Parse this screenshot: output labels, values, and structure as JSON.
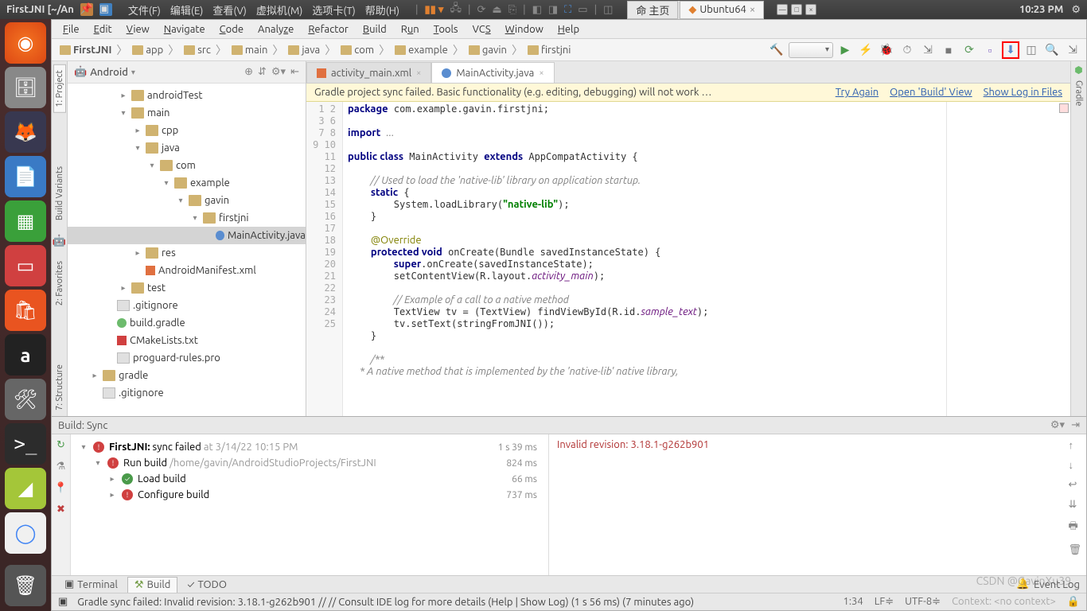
{
  "top": {
    "title": "FirstJNI [~/An",
    "vm_menus": [
      "文件(F)",
      "编辑(E)",
      "查看(V)",
      "虚拟机(M)",
      "选项卡(T)",
      "帮助(H)"
    ],
    "vm_tabs": [
      {
        "label": "命 主页"
      },
      {
        "label": "Ubuntu64",
        "close": true,
        "active": true
      }
    ],
    "clock": "10:23 PM"
  },
  "menu": [
    "File",
    "Edit",
    "View",
    "Navigate",
    "Code",
    "Analyze",
    "Refactor",
    "Build",
    "Run",
    "Tools",
    "VCS",
    "Window",
    "Help"
  ],
  "breadcrumb": [
    "FirstJNI",
    "app",
    "src",
    "main",
    "java",
    "com",
    "example",
    "gavin",
    "firstjni"
  ],
  "project": {
    "label": "Android",
    "tree": [
      {
        "d": 1,
        "a": "▸",
        "i": "folder",
        "t": "androidTest"
      },
      {
        "d": 1,
        "a": "▾",
        "i": "folder",
        "t": "main"
      },
      {
        "d": 2,
        "a": "▸",
        "i": "folder",
        "t": "cpp"
      },
      {
        "d": 2,
        "a": "▾",
        "i": "folder",
        "t": "java"
      },
      {
        "d": 3,
        "a": "▾",
        "i": "folder",
        "t": "com"
      },
      {
        "d": 4,
        "a": "▾",
        "i": "folder",
        "t": "example"
      },
      {
        "d": 5,
        "a": "▾",
        "i": "folder",
        "t": "gavin"
      },
      {
        "d": 6,
        "a": "▾",
        "i": "folder",
        "t": "firstjni"
      },
      {
        "d": 7,
        "a": "",
        "i": "java",
        "t": "MainActivity.java",
        "sel": true
      },
      {
        "d": 2,
        "a": "▸",
        "i": "folder",
        "t": "res"
      },
      {
        "d": 2,
        "a": "",
        "i": "xml",
        "t": "AndroidManifest.xml"
      },
      {
        "d": 1,
        "a": "▸",
        "i": "folder",
        "t": "test"
      },
      {
        "d": 0,
        "a": "",
        "i": "file",
        "t": ".gitignore"
      },
      {
        "d": 0,
        "a": "",
        "i": "gradle",
        "t": "build.gradle"
      },
      {
        "d": 0,
        "a": "",
        "i": "cmake",
        "t": "CMakeLists.txt"
      },
      {
        "d": 0,
        "a": "",
        "i": "file",
        "t": "proguard-rules.pro"
      },
      {
        "d": -1,
        "a": "▸",
        "i": "folder",
        "t": "gradle"
      },
      {
        "d": -1,
        "a": "",
        "i": "file",
        "t": ".gitignore"
      }
    ]
  },
  "editor": {
    "tabs": [
      {
        "label": "activity_main.xml",
        "icon": "xml"
      },
      {
        "label": "MainActivity.java",
        "icon": "java",
        "active": true
      }
    ],
    "notice": {
      "msg": "Gradle project sync failed. Basic functionality (e.g. editing, debugging) will not work …",
      "links": [
        "Try Again",
        "Open 'Build' View",
        "Show Log in Files"
      ]
    },
    "lines": [
      "1",
      "2",
      "3",
      "6",
      "7",
      "8",
      "9",
      "10",
      "11",
      "12",
      "13",
      "14",
      "15",
      "16",
      "17",
      "18",
      "19",
      "20",
      "21",
      "22",
      "23",
      "24",
      "25"
    ]
  },
  "build": {
    "title": "Build: Sync",
    "rows": [
      {
        "d": 0,
        "a": "▾",
        "st": "err",
        "bold": "FirstJNI:",
        "text": " sync failed",
        "meta": "at 3/14/22 10:15 PM",
        "time": "1 s 39 ms"
      },
      {
        "d": 1,
        "a": "▾",
        "st": "err",
        "text": "Run build",
        "meta": "/home/gavin/AndroidStudioProjects/FirstJNI",
        "time": "824 ms"
      },
      {
        "d": 2,
        "a": "▸",
        "st": "ok",
        "text": "Load build",
        "time": "66 ms"
      },
      {
        "d": 2,
        "a": "▸",
        "st": "err",
        "text": "Configure build",
        "time": "737 ms"
      }
    ],
    "msg": "Invalid revision: 3.18.1-g262b901"
  },
  "bottom_tabs": {
    "terminal": "Terminal",
    "build": "Build",
    "todo": "TODO",
    "eventlog": "Event Log"
  },
  "status": {
    "msg": "Gradle sync failed: Invalid revision: 3.18.1-g262b901 // // Consult IDE log for more details (Help | Show Log) (1 s 56 ms) (7 minutes ago)",
    "pos": "1:34",
    "le": "LF",
    "enc": "UTF-8",
    "ctx": "Context: <no context>"
  },
  "left_tabs": [
    "1: Project",
    "Build Variants",
    "2: Favorites",
    "7: Structure"
  ],
  "right_tabs": [
    "Gradle"
  ],
  "watermark": "CSDN @GavinXu39"
}
